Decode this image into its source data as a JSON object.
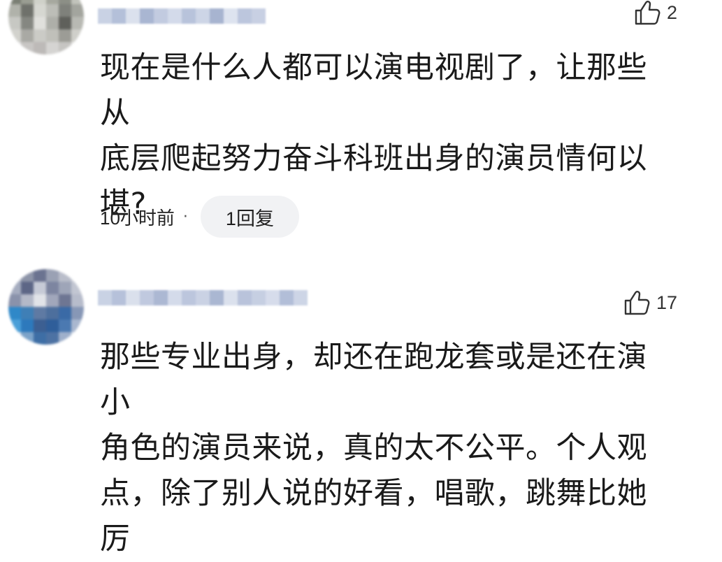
{
  "comments": [
    {
      "likes": "2",
      "text": "现在是什么人都可以演电视剧了，让那些从\n底层爬起努力奋斗科班出身的演员情何以\n堪?",
      "time": "10小时前",
      "dot": "·",
      "reply_label": "1回复"
    },
    {
      "likes": "17",
      "text": "那些专业出身，却还在跑龙套或是还在演小\n角色的演员来说，真的太不公平。个人观\n点，除了别人说的好看，唱歌，跳舞比她厉"
    }
  ],
  "icons": {
    "like": "thumbs-up-icon"
  },
  "colors": {
    "text": "#1a1a1a",
    "reply_bg": "#f1f2f4",
    "username_blur": "#b8c4dc"
  }
}
